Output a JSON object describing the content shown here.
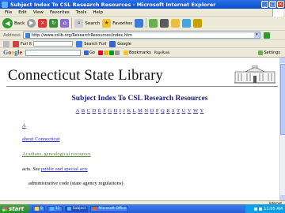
{
  "window": {
    "title": "Subject Index To CSL Research Resources - Microsoft Internet Explorer"
  },
  "menu": [
    "File",
    "Edit",
    "View",
    "Favorites",
    "Tools",
    "Help"
  ],
  "toolbar": {
    "back_label": "Back",
    "search_label": "Search",
    "favorites_label": "Favorites"
  },
  "address": {
    "label": "Address",
    "url": "http://www.cslib.org/ResearchResources/index.htm"
  },
  "links_bar": {
    "furl_label": "Furl It",
    "search_furl_label": "Search Furl",
    "google_label": "Google"
  },
  "google_bar": {
    "logo": [
      "G",
      "o",
      "o",
      "g",
      "l",
      "e"
    ],
    "go_label": "Go",
    "bookmarks_label": "Bookmarks",
    "pagerank_label": "PageRank",
    "settings_label": "Settings"
  },
  "page": {
    "site_title": "Connecticut State Library",
    "heading": "Subject Index To CSL Research Resources",
    "letters": [
      "A",
      "B",
      "C",
      "D",
      "E",
      "F",
      "G",
      "H",
      "I",
      "J",
      "K",
      "L",
      "M",
      "N",
      "O",
      "P",
      "Q",
      "R",
      "S",
      "T",
      "U",
      "V",
      "W",
      "Y"
    ],
    "entries": {
      "letter_a": "A",
      "about_ct": "about Connecticut",
      "acadians": "Acadians, genealogical resources",
      "acts_prefix": "acts.",
      "see": "See",
      "acts_link": "public and special acts",
      "admin_code": "administrative code (state agency regulations)"
    }
  },
  "status": {
    "zone": "Internet"
  },
  "taskbar": {
    "start": "start",
    "tasks": [
      "8",
      "12",
      "Subject",
      "Microsoft Office"
    ],
    "clock": "11:05 AM"
  },
  "colors": {
    "heading": "#1a1a8c",
    "link_blue": "#2a2ac0",
    "link_green": "#5a8a3a",
    "titlebar": "#0b4fd0"
  }
}
